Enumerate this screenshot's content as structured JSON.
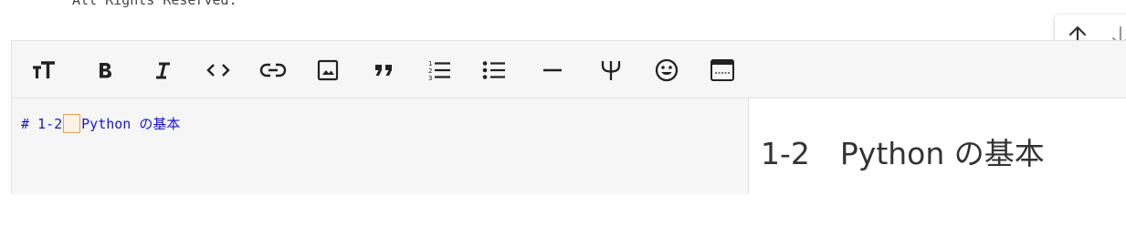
{
  "footer": {
    "copyright_text": "All Rights Reserved."
  },
  "scroll_nav": {
    "up_icon": "arrow-up-icon",
    "down_icon": "arrow-down-icon"
  },
  "toolbar": {
    "buttons": [
      {
        "name": "heading-button",
        "icon": "text-size-icon"
      },
      {
        "name": "bold-button",
        "icon": "bold-icon"
      },
      {
        "name": "italic-button",
        "icon": "italic-icon"
      },
      {
        "name": "code-button",
        "icon": "code-icon"
      },
      {
        "name": "link-button",
        "icon": "link-icon"
      },
      {
        "name": "image-button",
        "icon": "image-icon"
      },
      {
        "name": "quote-button",
        "icon": "quote-icon"
      },
      {
        "name": "ordered-list-button",
        "icon": "ordered-list-icon"
      },
      {
        "name": "unordered-list-button",
        "icon": "bullet-list-icon"
      },
      {
        "name": "horizontal-rule-button",
        "icon": "horizontal-rule-icon"
      },
      {
        "name": "math-button",
        "icon": "psi-icon"
      },
      {
        "name": "emoji-button",
        "icon": "smiley-icon"
      },
      {
        "name": "preview-toggle-button",
        "icon": "window-icon"
      }
    ]
  },
  "editor": {
    "code_prefix": "# 1-2",
    "code_suffix": "Python の基本"
  },
  "preview": {
    "heading": "1-2　Python の基本"
  },
  "colors": {
    "code_text": "#1515d6",
    "fullwidth_space_border": "#e0a254",
    "toolbar_bg": "#f6f6f6"
  }
}
